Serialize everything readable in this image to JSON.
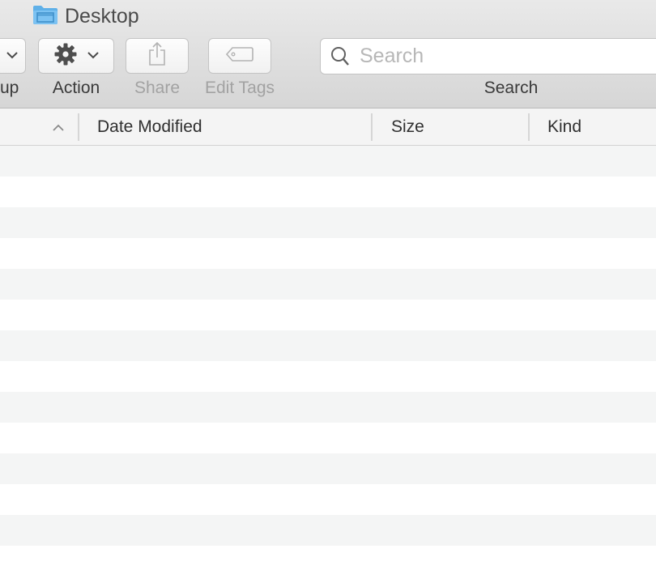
{
  "window": {
    "title": "Desktop",
    "folder_icon": "folder-icon"
  },
  "toolbar": {
    "group_label_partial": "up",
    "action_label": "Action",
    "share_label": "Share",
    "edit_tags_label": "Edit Tags",
    "search_label": "Search"
  },
  "search": {
    "placeholder": "Search",
    "value": ""
  },
  "columns": {
    "name_sort": "ascending",
    "date_modified": "Date Modified",
    "size": "Size",
    "kind": "Kind"
  },
  "file_rows": [],
  "colors": {
    "folder_blue": "#5fb0e8",
    "toolbar_bg": "#dedede",
    "row_stripe": "#f4f5f5",
    "disabled_text": "#a2a2a2"
  }
}
